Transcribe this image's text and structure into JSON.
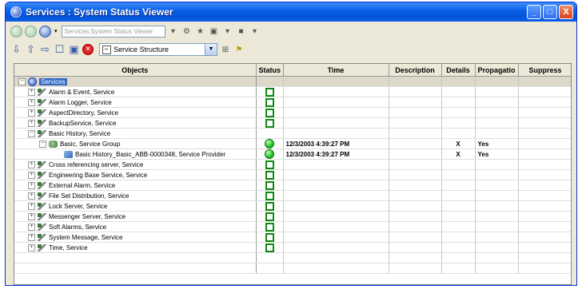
{
  "window": {
    "title": "Services : System Status Viewer",
    "buttons": {
      "minimize": "_",
      "maximize": "□",
      "close": "X"
    }
  },
  "toolbar1": {
    "path_placeholder": "Services:System Status Viewer"
  },
  "toolbar2": {
    "structure_select": "Service Structure"
  },
  "grid": {
    "columns": [
      "Objects",
      "Status",
      "Time",
      "Description",
      "Details",
      "Propagatio",
      "Suppress"
    ],
    "rows": [
      {
        "name": "Services",
        "level": 0,
        "expander": "−",
        "icon": "services-icon",
        "selected": true,
        "status": "",
        "time": "",
        "description": "",
        "details": "",
        "propagation": "",
        "suppress": ""
      },
      {
        "name": "Alarm & Event, Service",
        "level": 1,
        "expander": "+",
        "icon": "service-icon",
        "selected": false,
        "status": "unknown",
        "time": "",
        "description": "",
        "details": "",
        "propagation": "",
        "suppress": ""
      },
      {
        "name": "Alarm Logger, Service",
        "level": 1,
        "expander": "+",
        "icon": "service-icon",
        "selected": false,
        "status": "unknown",
        "time": "",
        "description": "",
        "details": "",
        "propagation": "",
        "suppress": ""
      },
      {
        "name": "AspectDirectory, Service",
        "level": 1,
        "expander": "+",
        "icon": "service-icon",
        "selected": false,
        "status": "unknown",
        "time": "",
        "description": "",
        "details": "",
        "propagation": "",
        "suppress": ""
      },
      {
        "name": "BackupService, Service",
        "level": 1,
        "expander": "+",
        "icon": "service-icon",
        "selected": false,
        "status": "unknown",
        "time": "",
        "description": "",
        "details": "",
        "propagation": "",
        "suppress": ""
      },
      {
        "name": "Basic History, Service",
        "level": 1,
        "expander": "−",
        "icon": "service-icon",
        "selected": false,
        "status": "",
        "time": "",
        "description": "",
        "details": "",
        "propagation": "",
        "suppress": ""
      },
      {
        "name": "Basic, Service Group",
        "level": 2,
        "expander": "−",
        "icon": "service-group-icon",
        "selected": false,
        "status": "ok",
        "time": "12/3/2003 4:39:27 PM",
        "description": "",
        "details": "X",
        "propagation": "Yes",
        "suppress": ""
      },
      {
        "name": "Basic History_Basic_ABB-0000348, Service Provider",
        "level": 3,
        "expander": "",
        "icon": "service-provider-icon",
        "selected": false,
        "status": "ok",
        "time": "12/3/2003 4:39:27 PM",
        "description": "",
        "details": "X",
        "propagation": "Yes",
        "suppress": ""
      },
      {
        "name": "Cross referencing server, Service",
        "level": 1,
        "expander": "+",
        "icon": "service-icon",
        "selected": false,
        "status": "unknown",
        "time": "",
        "description": "",
        "details": "",
        "propagation": "",
        "suppress": ""
      },
      {
        "name": "Engineering Base Service, Service",
        "level": 1,
        "expander": "+",
        "icon": "service-icon",
        "selected": false,
        "status": "unknown",
        "time": "",
        "description": "",
        "details": "",
        "propagation": "",
        "suppress": ""
      },
      {
        "name": "External Alarm, Service",
        "level": 1,
        "expander": "+",
        "icon": "service-icon",
        "selected": false,
        "status": "unknown",
        "time": "",
        "description": "",
        "details": "",
        "propagation": "",
        "suppress": ""
      },
      {
        "name": "File Set Distribution, Service",
        "level": 1,
        "expander": "+",
        "icon": "service-icon",
        "selected": false,
        "status": "unknown",
        "time": "",
        "description": "",
        "details": "",
        "propagation": "",
        "suppress": ""
      },
      {
        "name": "Lock Server, Service",
        "level": 1,
        "expander": "+",
        "icon": "service-icon",
        "selected": false,
        "status": "unknown",
        "time": "",
        "description": "",
        "details": "",
        "propagation": "",
        "suppress": ""
      },
      {
        "name": "Messenger Server, Service",
        "level": 1,
        "expander": "+",
        "icon": "service-icon",
        "selected": false,
        "status": "unknown",
        "time": "",
        "description": "",
        "details": "",
        "propagation": "",
        "suppress": ""
      },
      {
        "name": "Soft Alarms, Service",
        "level": 1,
        "expander": "+",
        "icon": "service-icon",
        "selected": false,
        "status": "unknown",
        "time": "",
        "description": "",
        "details": "",
        "propagation": "",
        "suppress": ""
      },
      {
        "name": "System Message, Service",
        "level": 1,
        "expander": "+",
        "icon": "service-icon",
        "selected": false,
        "status": "unknown",
        "time": "",
        "description": "",
        "details": "",
        "propagation": "",
        "suppress": ""
      },
      {
        "name": "Time, Service",
        "level": 1,
        "expander": "+",
        "icon": "service-icon",
        "selected": false,
        "status": "unknown",
        "time": "",
        "description": "",
        "details": "",
        "propagation": "",
        "suppress": ""
      }
    ]
  }
}
